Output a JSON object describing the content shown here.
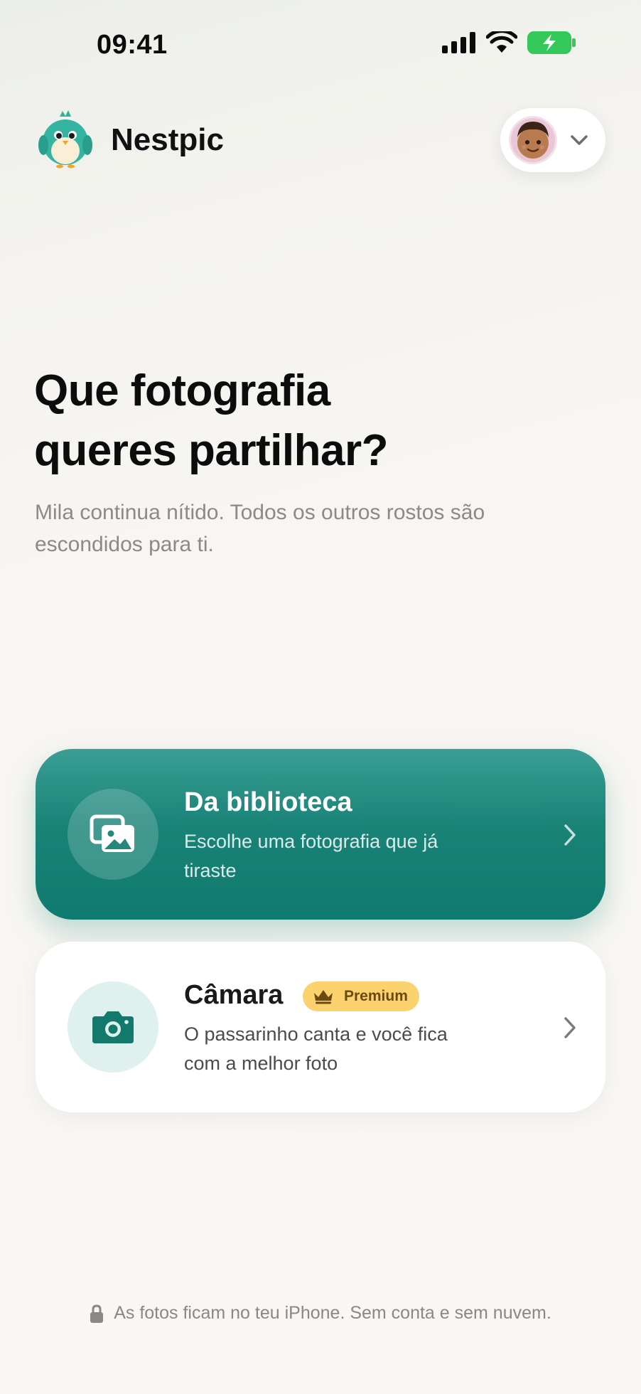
{
  "status_bar": {
    "time": "09:41",
    "signal_icon": "cellular-signal-icon",
    "wifi_icon": "wifi-icon",
    "battery_icon": "battery-charging-icon",
    "battery_color": "#34c759"
  },
  "header": {
    "app_name": "Nestpic",
    "logo_icon": "bird-mascot-icon",
    "profile_icon": "avatar",
    "dropdown_icon": "chevron-down-icon"
  },
  "main": {
    "headline_line1": "Que fotografia",
    "headline_line2": "queres partilhar?",
    "subtitle": "Mila continua nítido. Todos os outros rostos são escondidos para ti."
  },
  "cards": {
    "library": {
      "title": "Da biblioteca",
      "description": "Escolhe uma fotografia que já tiraste",
      "icon": "photo-library-icon",
      "accent": "#0f7a6f"
    },
    "camera": {
      "title": "Câmara",
      "badge": "Premium",
      "badge_icon": "crown-icon",
      "badge_color": "#fbd26e",
      "description": "O passarinho canta e você fica com a melhor foto",
      "icon": "camera-icon"
    }
  },
  "footer": {
    "text": "As fotos ficam no teu iPhone. Sem conta e sem nuvem.",
    "icon": "lock-icon"
  }
}
